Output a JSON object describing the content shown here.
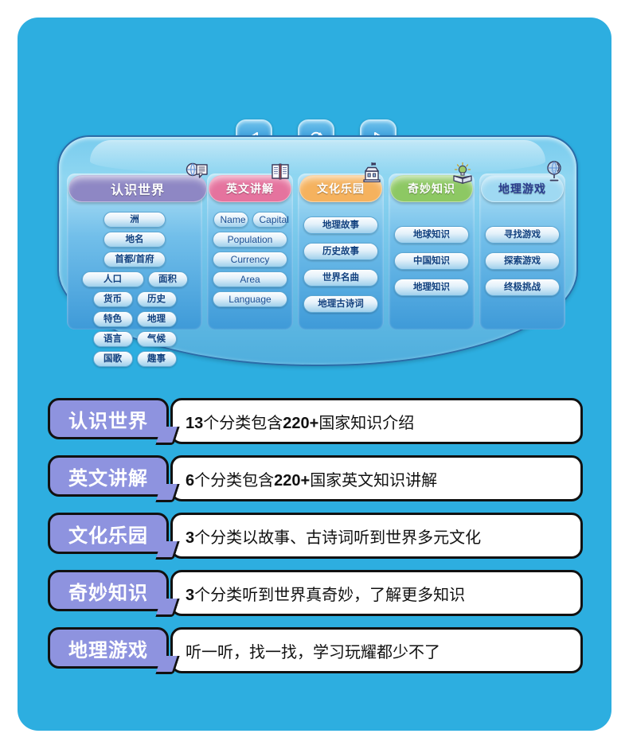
{
  "theme": {
    "card_bg": "#2DAEE0",
    "tag_purple": "#8E93DF",
    "panel_blue": "#6FC2E8"
  },
  "nav": {
    "prev": "prev-button",
    "repeat": "repeat-button",
    "next": "next-button"
  },
  "columns": [
    {
      "tab_label": "认识世界",
      "tab_color": "#8E87C4",
      "icon": "globe-speech-icon",
      "items": [
        {
          "label": "洲",
          "w": "w-half"
        },
        {
          "label": "地名",
          "w": "w-half"
        },
        {
          "label": "首都/首府",
          "w": "w-half"
        },
        {
          "label": "人口",
          "w": "w-half"
        },
        {
          "label": "面积",
          "w": "w-third"
        },
        {
          "label": "货币",
          "w": "w-third"
        },
        {
          "label": "历史",
          "w": "w-third"
        },
        {
          "label": "特色",
          "w": "w-third"
        },
        {
          "label": "地理",
          "w": "w-third"
        },
        {
          "label": "语言",
          "w": "w-third"
        },
        {
          "label": "气候",
          "w": "w-third"
        },
        {
          "label": "国歌",
          "w": "w-third"
        },
        {
          "label": "趣事",
          "w": "w-third"
        }
      ]
    },
    {
      "tab_label": "英文讲解",
      "tab_color": "#E5739E",
      "icon": "open-book-icon",
      "items": [
        {
          "label": "Name",
          "w": "w-half",
          "eng": true
        },
        {
          "label": "Capital",
          "w": "w-half",
          "eng": true
        },
        {
          "label": "Population",
          "w": "w-full",
          "eng": true
        },
        {
          "label": "Currency",
          "w": "w-full",
          "eng": true
        },
        {
          "label": "Area",
          "w": "w-full",
          "eng": true
        },
        {
          "label": "Language",
          "w": "w-full",
          "eng": true
        }
      ]
    },
    {
      "tab_label": "文化乐园",
      "tab_color": "#F5B25E",
      "icon": "monument-icon",
      "items": [
        {
          "label": "地理故事",
          "w": "w-full"
        },
        {
          "label": "历史故事",
          "w": "w-full"
        },
        {
          "label": "世界名曲",
          "w": "w-full"
        },
        {
          "label": "地理古诗词",
          "w": "w-full"
        }
      ]
    },
    {
      "tab_label": "奇妙知识",
      "tab_color": "#8DC863",
      "icon": "lightbulb-book-icon",
      "items": [
        {
          "label": "地球知识",
          "w": "w-full"
        },
        {
          "label": "中国知识",
          "w": "w-full"
        },
        {
          "label": "地理知识",
          "w": "w-full"
        }
      ]
    },
    {
      "tab_label": "地理游戏",
      "tab_color": "#9FD9F2",
      "icon": "globe-stand-icon",
      "items": [
        {
          "label": "寻找游戏",
          "w": "w-full"
        },
        {
          "label": "探索游戏",
          "w": "w-full"
        },
        {
          "label": "终极挑战",
          "w": "w-full"
        }
      ]
    }
  ],
  "rows": [
    {
      "tag": "认识世界",
      "bold": "13",
      "text": "个分类包含",
      "bold2": "220+",
      "text2": "国家知识介绍"
    },
    {
      "tag": "英文讲解",
      "bold": "6",
      "text": "个分类包含",
      "bold2": "220+",
      "text2": "国家英文知识讲解"
    },
    {
      "tag": "文化乐园",
      "bold": "3",
      "text": "个分类以故事、古诗词听到世界多元文化",
      "bold2": "",
      "text2": ""
    },
    {
      "tag": "奇妙知识",
      "bold": "3",
      "text": "个分类听到世界真奇妙，了解更多知识",
      "bold2": "",
      "text2": ""
    },
    {
      "tag": "地理游戏",
      "bold": "",
      "text": "听一听，找一找，学习玩耀都少不了",
      "bold2": "",
      "text2": ""
    }
  ]
}
